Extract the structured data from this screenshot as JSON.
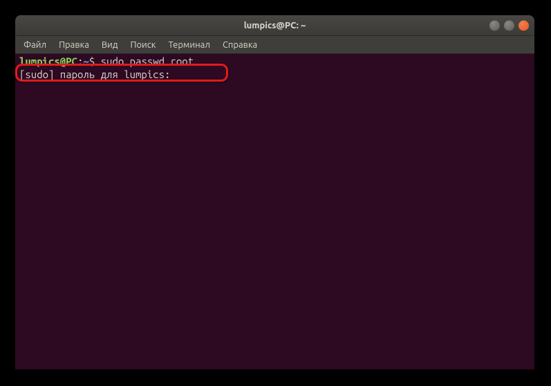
{
  "window": {
    "title": "lumpics@PC: ~"
  },
  "menu": {
    "file": "Файл",
    "edit": "Правка",
    "view": "Вид",
    "search": "Поиск",
    "terminal": "Терминал",
    "help": "Справка"
  },
  "terminal": {
    "prompt_user_host": "lumpics@PC",
    "prompt_colon": ":",
    "prompt_path": "~",
    "prompt_symbol": "$",
    "command": "sudo passwd root",
    "output_line1": "[sudo] пароль для lumpics: "
  }
}
